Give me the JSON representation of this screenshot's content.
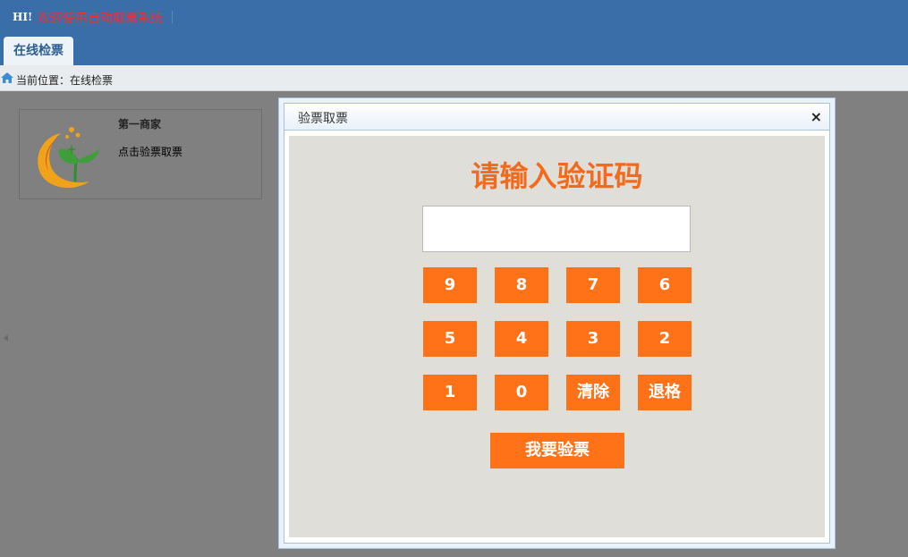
{
  "header": {
    "hi": "HI!",
    "welcome": "欢迎使用自动取票系统",
    "tab_label": "在线检票"
  },
  "breadcrumb": {
    "text": "当前位置：在线检票"
  },
  "merchant": {
    "name": "第一商家",
    "link": "点击验票取票"
  },
  "dialog": {
    "title": "验票取票",
    "close": "×",
    "prompt": "请输入验证码",
    "input_value": "",
    "keys": [
      "9",
      "8",
      "7",
      "6",
      "5",
      "4",
      "3",
      "2",
      "1",
      "0",
      "清除",
      "退格"
    ],
    "submit": "我要验票"
  },
  "colors": {
    "header_bg": "#3a6ea8",
    "welcome_text": "#ff2a2a",
    "accent_orange": "#ff7218",
    "prompt_text": "#f26a1b"
  },
  "icons": {
    "breadcrumb": "home-icon",
    "merchant": "leaf-logo",
    "dialog_close": "close-icon"
  }
}
